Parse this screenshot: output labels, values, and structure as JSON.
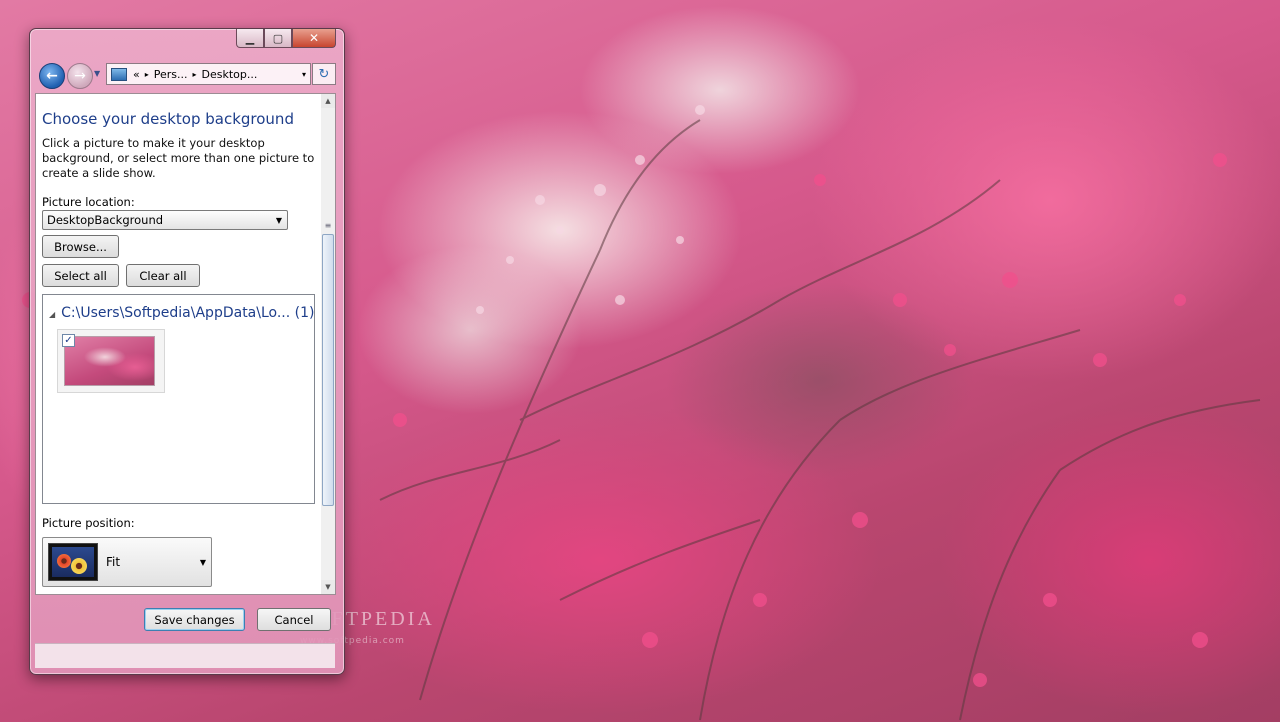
{
  "desktop": {
    "watermark": "SOFTPEDIA",
    "watermark_url": "www.softpedia.com"
  },
  "window": {
    "caption_buttons": {
      "minimize": "▁",
      "maximize": "▢",
      "close": "✕"
    },
    "nav": {
      "back_icon": "back-arrow-icon",
      "forward_icon": "forward-arrow-icon",
      "history_icon": "chevron-down-icon"
    },
    "address": {
      "overflow": "«",
      "segments": [
        "Pers...",
        "Desktop..."
      ],
      "separator": "▸",
      "dropdown": "▾"
    },
    "refresh_glyph": "↻"
  },
  "content": {
    "title": "Choose your desktop background",
    "description": "Click a picture to make it your desktop background, or select more than one picture to create a slide show.",
    "picture_location_label": "Picture location:",
    "picture_location_value": "DesktopBackground",
    "browse_label": "Browse...",
    "select_all_label": "Select all",
    "clear_all_label": "Clear all",
    "group": {
      "path": "C:\\Users\\Softpedia\\AppData\\Lo...",
      "count": "(1)",
      "items": [
        {
          "checked": true
        }
      ]
    },
    "picture_position_label": "Picture position:",
    "picture_position_value": "Fit"
  },
  "footer": {
    "save_label": "Save changes",
    "cancel_label": "Cancel"
  },
  "colors": {
    "title_blue": "#1e3e8a",
    "window_frame": "#e2a0c0",
    "wallpaper_pink": "#d6598c"
  }
}
